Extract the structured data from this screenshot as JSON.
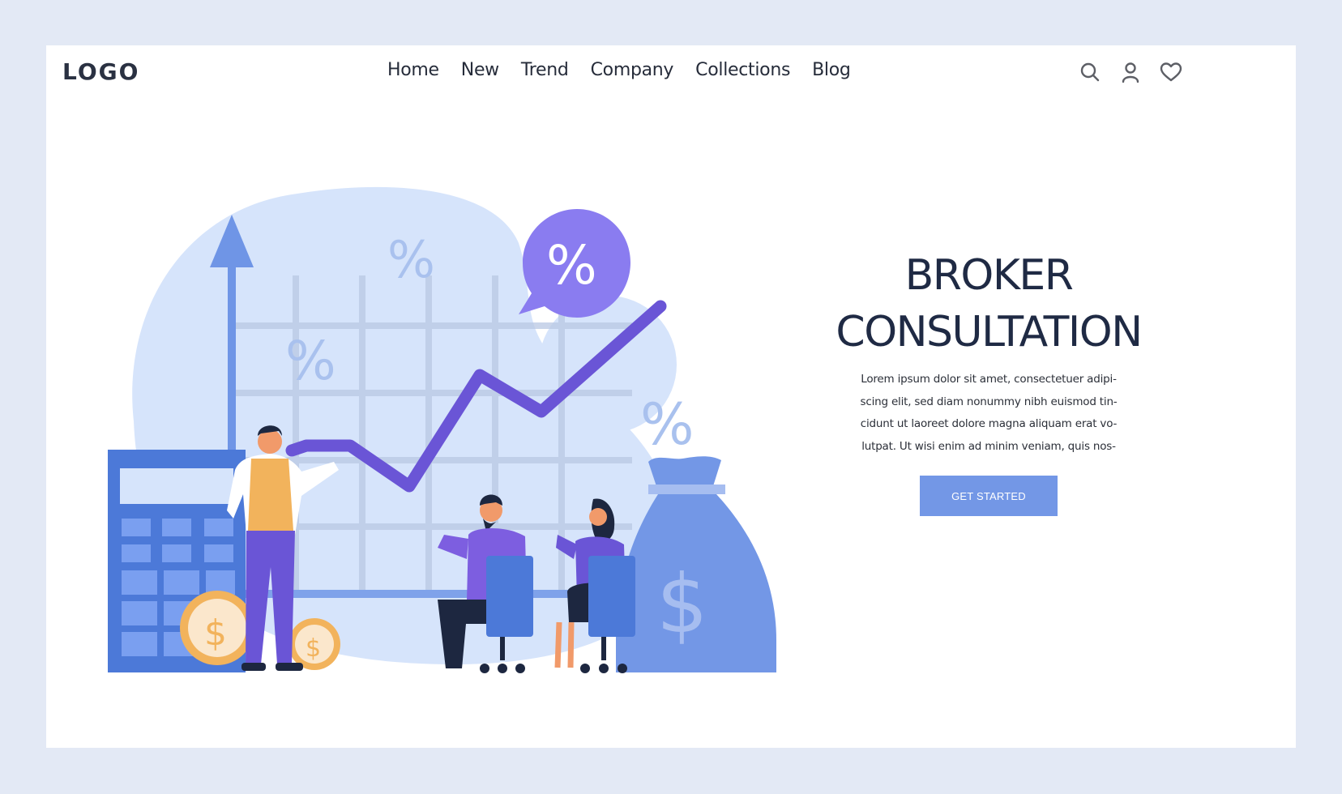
{
  "header": {
    "logo": "LOGO",
    "nav": [
      {
        "label": "Home"
      },
      {
        "label": "New"
      },
      {
        "label": "Trend"
      },
      {
        "label": "Company"
      },
      {
        "label": "Collections"
      },
      {
        "label": "Blog"
      }
    ],
    "icons": [
      "search-icon",
      "user-icon",
      "heart-icon"
    ]
  },
  "hero": {
    "title_line1": "BROKER",
    "title_line2": "CONSULTATION",
    "body_lines": [
      "Lorem ipsum dolor sit amet, consectetuer adipi-",
      "scing elit, sed diam nonummy nibh euismod tin-",
      "cidunt ut laoreet dolore magna aliquam erat vo-",
      "lutpat. Ut wisi enim ad minim veniam, quis nos-"
    ],
    "cta_label": "GET STARTED"
  },
  "illustration": {
    "percent_symbol": "%",
    "dollar_symbol": "$"
  },
  "colors": {
    "page_bg": "#e3e9f5",
    "card_bg": "#ffffff",
    "text_dark": "#1f2a44",
    "accent_blue": "#7397e6",
    "accent_purple": "#6a55d6",
    "bubble_purple": "#8a7cf0",
    "blob_light": "#d6e4fb",
    "coin_orange": "#f2b35c"
  }
}
